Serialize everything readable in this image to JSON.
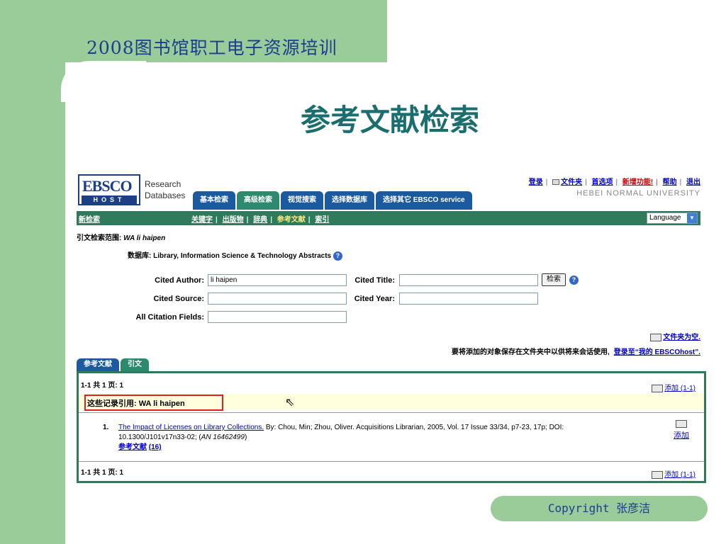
{
  "slide": {
    "header": "2008图书馆职工电子资源培训",
    "title": "参考文献检索",
    "copyright": "Copyright  张彦洁"
  },
  "ebsco": {
    "logo": {
      "ebsco": "EBSCO",
      "host": "HOST",
      "research": "Research",
      "databases": "Databases"
    },
    "top_links": [
      "登录",
      "文件夹",
      "首选项",
      "新增功能!",
      "帮助",
      "退出"
    ],
    "university": "HEBEI NORMAL UNIVERSITY",
    "tabs": [
      "基本检索",
      "高级检索",
      "视觉搜索",
      "选择数据库",
      "选择其它 EBSCO service"
    ],
    "active_tab": 1,
    "nav": {
      "new_search": "新检索",
      "links": [
        "关键字",
        "出版物",
        "辞典",
        "参考文献",
        "索引"
      ],
      "current": "参考文献",
      "language": "Language"
    },
    "scope_label": "引文检索范围:",
    "scope_value": "WA li haipen",
    "database_line": "数据库: Library, Information Science & Technology Abstracts",
    "form": {
      "cited_author_label": "Cited Author:",
      "cited_author_value": "li haipen",
      "cited_title_label": "Cited Title:",
      "cited_title_value": "",
      "search_button": "检索",
      "cited_source_label": "Cited Source:",
      "cited_source_value": "",
      "cited_year_label": "Cited Year:",
      "cited_year_value": "",
      "all_fields_label": "All Citation Fields:",
      "all_fields_value": ""
    },
    "folder_empty": "文件夹为空.",
    "save_note": "要将添加的对象保存在文件夹中以供将来会话使用,",
    "save_link": "登录至“我的 EBSCOhost”.",
    "result_tabs": [
      "参考文献",
      "引文"
    ],
    "active_result_tab": 1,
    "results": {
      "count": "1-1 共 1 页: 1",
      "add_range": "添加 (1-1)",
      "cited_by_label": "这些记录引用:",
      "cited_by_value": "WA li haipen",
      "record": {
        "number": "1.",
        "title": "The Impact of Licenses on Library Collections.",
        "detail": "By: Chou, Min; Zhou, Oliver. Acquisitions Librarian, 2005, Vol. 17 Issue 33/34, p7-23, 17p; DOI: 10.1300/J101v17n33-02; (",
        "an": "AN 16462499",
        "detail_end": ")",
        "refs_label": "参考文献",
        "refs_count": "(16)",
        "add": "添加"
      },
      "count_bottom": "1-1 共 1 页: 1",
      "add_range_bottom": "添加 (1-1)"
    }
  }
}
